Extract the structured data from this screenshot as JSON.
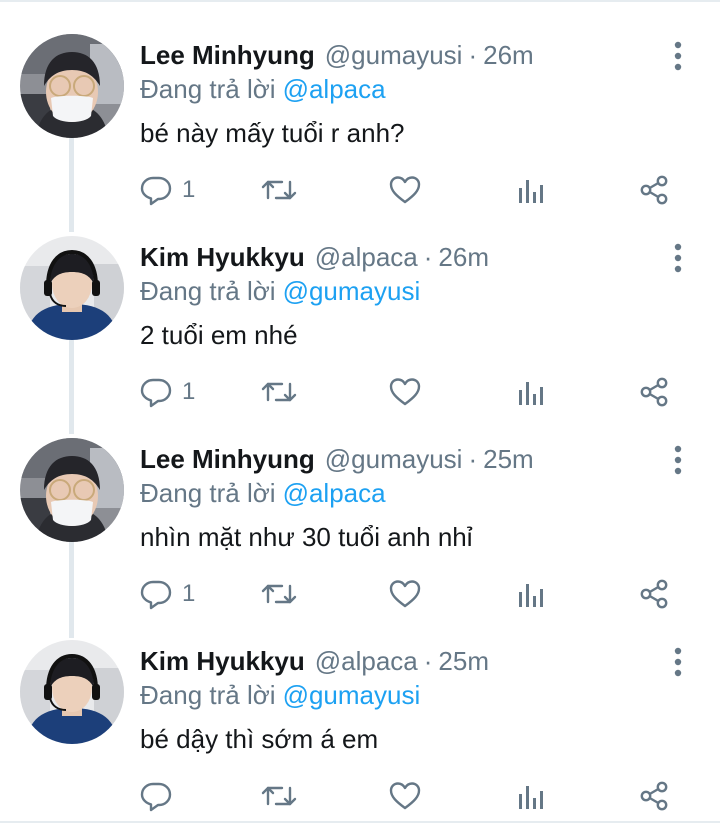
{
  "tweets": [
    {
      "display_name": "Lee Minhyung",
      "handle": "@gumayusi",
      "separator": "·",
      "time": "26m",
      "reply_prefix": "Đang trả lời",
      "reply_to": "@alpaca",
      "text": "bé này mấy tuổi r anh?",
      "reply_count": "1",
      "avatar": "masked-person-avatar"
    },
    {
      "display_name": "Kim Hyukkyu",
      "handle": "@alpaca",
      "separator": "·",
      "time": "26m",
      "reply_prefix": "Đang trả lời",
      "reply_to": "@gumayusi",
      "text": "2 tuổi em nhé",
      "reply_count": "1",
      "avatar": "headset-person-avatar"
    },
    {
      "display_name": "Lee Minhyung",
      "handle": "@gumayusi",
      "separator": "·",
      "time": "25m",
      "reply_prefix": "Đang trả lời",
      "reply_to": "@alpaca",
      "text": "nhìn mặt như 30 tuổi anh nhỉ",
      "reply_count": "1",
      "avatar": "masked-person-avatar"
    },
    {
      "display_name": "Kim Hyukkyu",
      "handle": "@alpaca",
      "separator": "·",
      "time": "25m",
      "reply_prefix": "Đang trả lời",
      "reply_to": "@gumayusi",
      "text": "bé dậy thì sớm á em",
      "reply_count": "",
      "avatar": "headset-person-avatar"
    }
  ],
  "icons": {
    "reply": "reply-icon",
    "retweet": "retweet-icon",
    "like": "heart-icon",
    "analytics": "analytics-icon",
    "share": "share-icon",
    "more": "more-vertical-icon"
  },
  "colors": {
    "name": "#14171a",
    "muted": "#657786",
    "link": "#1da1f2",
    "thread_line": "#e1e8ed",
    "background": "#ffffff"
  }
}
